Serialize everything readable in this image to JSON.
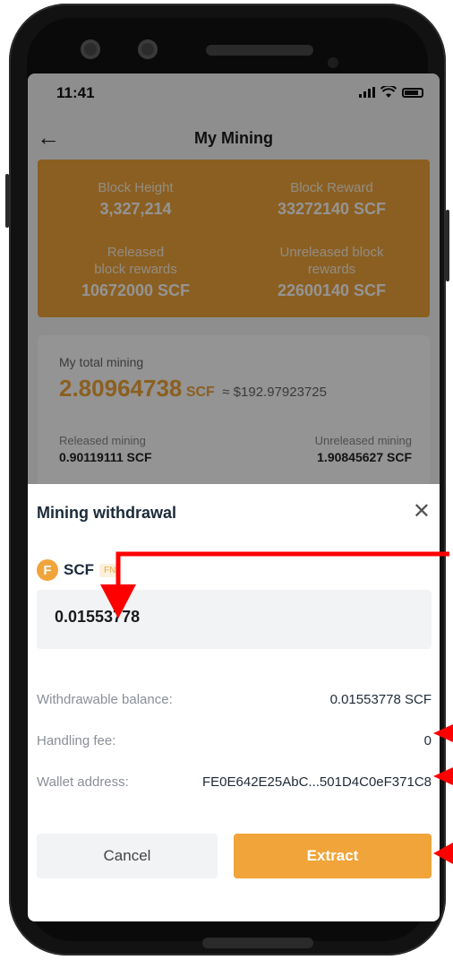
{
  "status_bar": {
    "time": "11:41"
  },
  "nav": {
    "title": "My Mining"
  },
  "block_stats": {
    "block_height_label": "Block Height",
    "block_height_value": "3,327,214",
    "block_reward_label": "Block Reward",
    "block_reward_value": "33272140 SCF",
    "released_label_line1": "Released",
    "released_label_line2": "block rewards",
    "released_value": "10672000 SCF",
    "unreleased_label_line1": "Unreleased block",
    "unreleased_label_line2": "rewards",
    "unreleased_value": "22600140 SCF"
  },
  "mining": {
    "total_label": "My total mining",
    "total_value": "2.80964738",
    "total_unit": "SCF",
    "total_usd": "≈ $192.97923725",
    "released_label": "Released mining",
    "released_value": "0.90119111 SCF",
    "unreleased_label": "Unreleased mining",
    "unreleased_value": "1.90845627 SCF"
  },
  "withdrawal": {
    "title": "Mining withdrawal",
    "coin_name": "SCF",
    "coin_tag": "FN",
    "amount": "0.01553778",
    "withdrawable_label": "Withdrawable balance:",
    "withdrawable_value": "0.01553778 SCF",
    "fee_label": "Handling fee:",
    "fee_value": "0",
    "wallet_label": "Wallet address:",
    "wallet_value": "FE0E642E25AbC...501D4C0eF371C8",
    "cancel_label": "Cancel",
    "extract_label": "Extract"
  },
  "colors": {
    "accent": "#f0a43a",
    "annotation": "#ff0000"
  }
}
